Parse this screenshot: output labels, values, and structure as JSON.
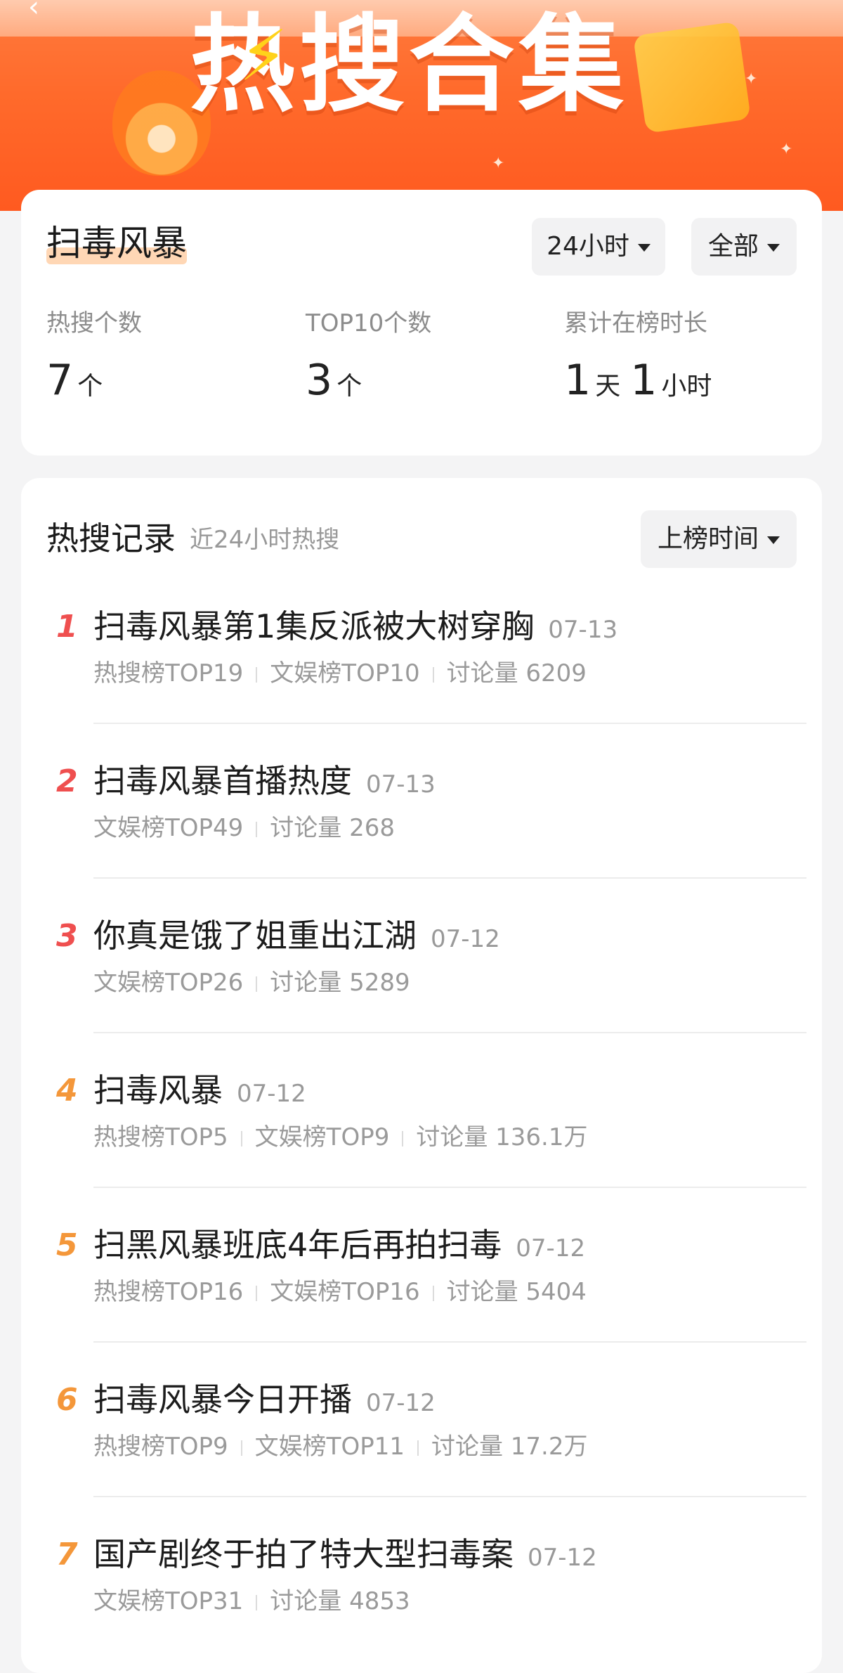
{
  "banner": {
    "title": "热搜合集"
  },
  "summary": {
    "topic": "扫毒风暴",
    "time_filter": "24小时",
    "scope_filter": "全部",
    "stats": [
      {
        "label": "热搜个数",
        "value": "7",
        "unit": "个"
      },
      {
        "label": "TOP10个数",
        "value": "3",
        "unit": "个"
      },
      {
        "label": "累计在榜时长",
        "value_days": "1",
        "unit_days": "天",
        "value_hours": "1",
        "unit_hours": "小时"
      }
    ]
  },
  "records": {
    "heading": "热搜记录",
    "subheading": "近24小时热搜",
    "sort_label": "上榜时间",
    "items": [
      {
        "rank": "1",
        "title": "扫毒风暴第1集反派被大树穿胸",
        "date": "07-13",
        "meta": [
          "热搜榜TOP19",
          "文娱榜TOP10",
          "讨论量 6209"
        ]
      },
      {
        "rank": "2",
        "title": "扫毒风暴首播热度",
        "date": "07-13",
        "meta": [
          "文娱榜TOP49",
          "讨论量 268"
        ]
      },
      {
        "rank": "3",
        "title": "你真是饿了姐重出江湖",
        "date": "07-12",
        "meta": [
          "文娱榜TOP26",
          "讨论量 5289"
        ]
      },
      {
        "rank": "4",
        "title": "扫毒风暴",
        "date": "07-12",
        "meta": [
          "热搜榜TOP5",
          "文娱榜TOP9",
          "讨论量 136.1万"
        ]
      },
      {
        "rank": "5",
        "title": "扫黑风暴班底4年后再拍扫毒",
        "date": "07-12",
        "meta": [
          "热搜榜TOP16",
          "文娱榜TOP16",
          "讨论量 5404"
        ]
      },
      {
        "rank": "6",
        "title": "扫毒风暴今日开播",
        "date": "07-12",
        "meta": [
          "热搜榜TOP9",
          "文娱榜TOP11",
          "讨论量 17.2万"
        ]
      },
      {
        "rank": "7",
        "title": "国产剧终于拍了特大型扫毒案",
        "date": "07-12",
        "meta": [
          "文娱榜TOP31",
          "讨论量 4853"
        ]
      }
    ]
  },
  "colors": {
    "accent": "#ff6a2b",
    "rank_top3": "#ef4f4f",
    "rank_other": "#f4973a"
  }
}
